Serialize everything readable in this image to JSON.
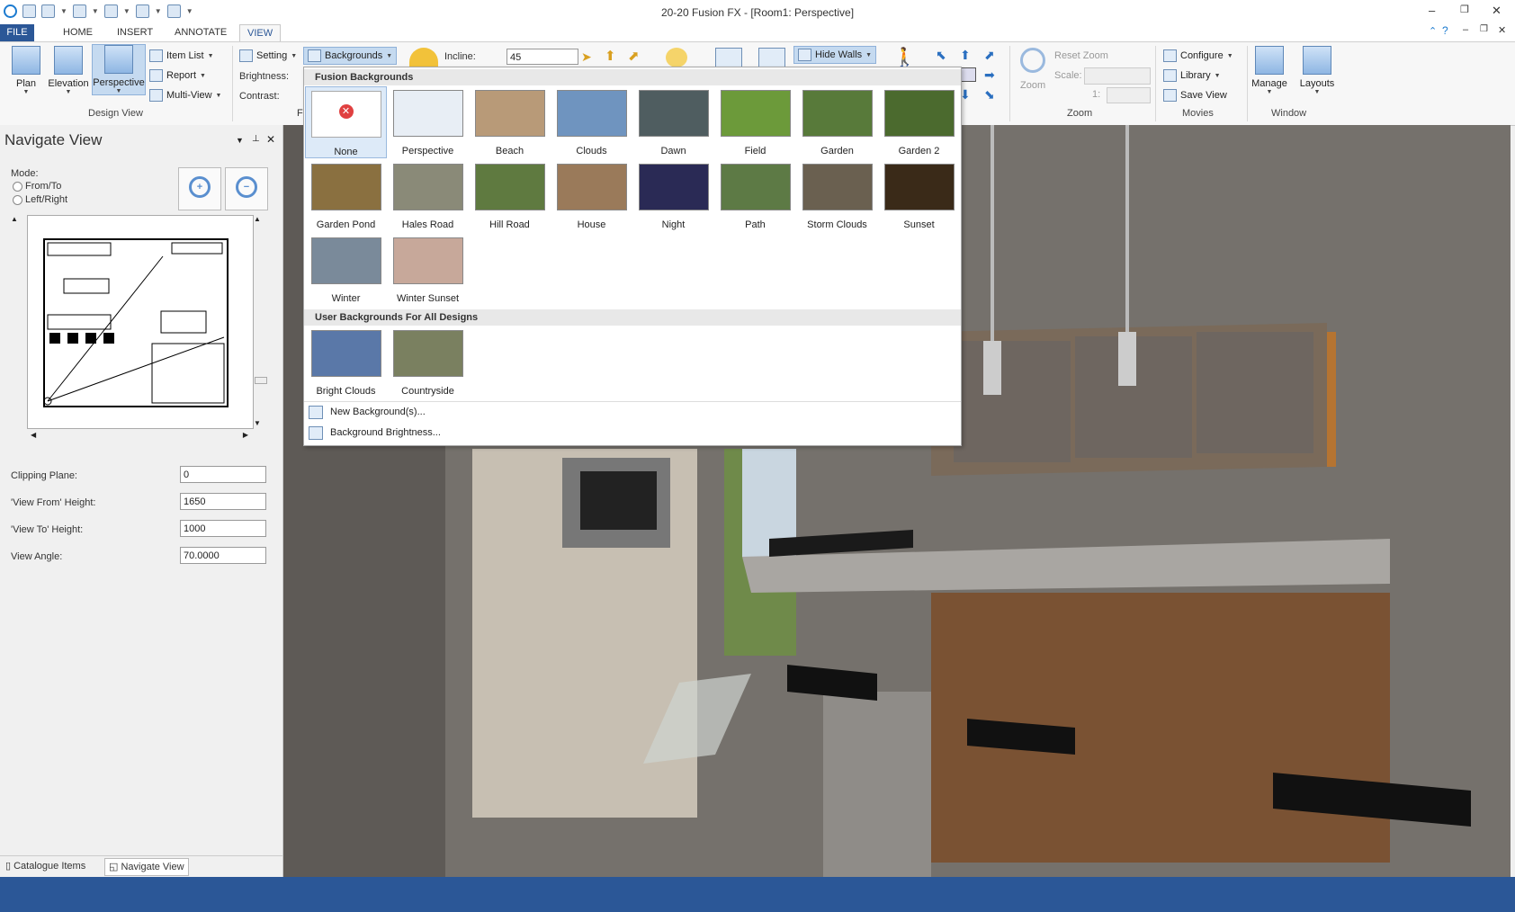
{
  "window": {
    "title": "20-20 Fusion FX - [Room1: Perspective]"
  },
  "tabs": {
    "file": "FILE",
    "home": "HOME",
    "insert": "INSERT",
    "annotate": "ANNOTATE",
    "view": "VIEW"
  },
  "ribbon": {
    "plan": "Plan",
    "elevation": "Elevation",
    "perspective": "Perspective",
    "item_list": "Item List",
    "report": "Report",
    "multi_view": "Multi-View",
    "design_view": "Design View",
    "setting": "Setting",
    "backgrounds": "Backgrounds",
    "brightness": "Brightness:",
    "contrast": "Contrast:",
    "incline_label": "Incline:",
    "incline_value": "45",
    "hide_walls": "Hide Walls",
    "zoom": "Zoom",
    "reset_zoom": "Reset Zoom",
    "scale": "Scale:",
    "scale_prefix": "1:",
    "zoom_group": "Zoom",
    "configure": "Configure",
    "library": "Library",
    "save_view": "Save View",
    "movies": "Movies",
    "manage": "Manage",
    "layouts": "Layouts",
    "window_group": "Window"
  },
  "navigate": {
    "title": "Navigate View",
    "mode_label": "Mode:",
    "mode_from_to": "From/To",
    "mode_left_right": "Left/Right",
    "clipping_label": "Clipping Plane:",
    "clipping_value": "0",
    "view_from_label": "'View From' Height:",
    "view_from_value": "1650",
    "view_to_label": "'View To' Height:",
    "view_to_value": "1000",
    "view_angle_label": "View Angle:",
    "view_angle_value": "70.0000"
  },
  "bottom_tabs": {
    "catalogue": "Catalogue Items",
    "navigate": "Navigate View"
  },
  "backgrounds_menu": {
    "fusion_header": "Fusion Backgrounds",
    "fusion": [
      {
        "name": "None",
        "color": "#ffffff"
      },
      {
        "name": "Perspective",
        "color": "#e8eef5"
      },
      {
        "name": "Beach",
        "color": "#b89a78"
      },
      {
        "name": "Clouds",
        "color": "#6f94bf"
      },
      {
        "name": "Dawn",
        "color": "#4f5d60"
      },
      {
        "name": "Field",
        "color": "#6c9a3a"
      },
      {
        "name": "Garden",
        "color": "#587a3a"
      },
      {
        "name": "Garden 2",
        "color": "#4b6a2e"
      },
      {
        "name": "Garden Pond",
        "color": "#8a7040"
      },
      {
        "name": "Hales Road",
        "color": "#8a8a78"
      },
      {
        "name": "Hill Road",
        "color": "#5f7a40"
      },
      {
        "name": "House",
        "color": "#9a7a5a"
      },
      {
        "name": "Night",
        "color": "#2a2a55"
      },
      {
        "name": "Path",
        "color": "#5d7a45"
      },
      {
        "name": "Storm Clouds",
        "color": "#6a6050"
      },
      {
        "name": "Sunset",
        "color": "#3a2a18"
      },
      {
        "name": "Winter",
        "color": "#7a8a9a"
      },
      {
        "name": "Winter Sunset",
        "color": "#c7a89a"
      }
    ],
    "user_header": "User Backgrounds For All Designs",
    "user": [
      {
        "name": "Bright Clouds",
        "color": "#5a78a8"
      },
      {
        "name": "Countryside",
        "color": "#7a8060"
      }
    ],
    "new_background": "New Background(s)...",
    "background_brightness": "Background Brightness..."
  }
}
